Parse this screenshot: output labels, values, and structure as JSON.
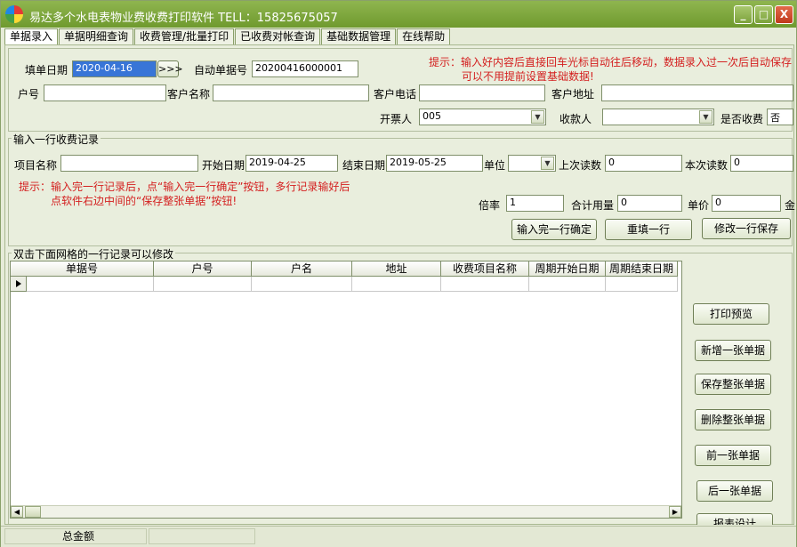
{
  "window": {
    "title": "易达多个水电表物业费收费打印软件   TELL：15825675057",
    "minimize": "_",
    "maximize": "□",
    "close": "X"
  },
  "tabs": [
    "单据录入",
    "单据明细查询",
    "收费管理/批量打印",
    "已收费对帐查询",
    "基础数据管理",
    "在线帮助"
  ],
  "header": {
    "fill_date_label": "填单日期",
    "fill_date_value": "2020-04-16",
    "date_button": ">>>",
    "auto_no_label": "自动单据号",
    "auto_no_value": "20200416000001",
    "hint_line1": "提示：输入好内容后直接回车光标自动往后移动，数据录入过一次后自动保存",
    "hint_line2": "可以不用提前设置基础数据!",
    "account_label": "户号",
    "customer_name_label": "客户名称",
    "customer_phone_label": "客户电话",
    "customer_address_label": "客户地址",
    "issuer_label": "开票人",
    "issuer_value": "005",
    "payee_label": "收款人",
    "payee_value": "",
    "charged_label": "是否收费",
    "charged_value": "否"
  },
  "row_entry": {
    "group_title": "输入一行收费记录",
    "item_name_label": "项目名称",
    "start_date_label": "开始日期",
    "start_date_value": "2019-04-25",
    "end_date_label": "结束日期",
    "end_date_value": "2019-05-25",
    "unit_label": "单位",
    "last_reading_label": "上次读数",
    "last_reading_value": "0",
    "this_reading_label": "本次读数",
    "this_reading_value": "0",
    "hint_line1": "提示：输入完一行记录后，点“输入完一行确定”按钮，多行记录输好后",
    "hint_line2": "点软件右边中间的“保存整张单据”按钮!",
    "ratio_label": "倍率",
    "ratio_value": "1",
    "total_usage_label": "合计用量",
    "total_usage_value": "0",
    "price_label": "单价",
    "price_value": "0",
    "amount_label": "金",
    "confirm_button": "输入完一行确定",
    "refill_button": "重填一行",
    "modify_button": "修改一行保存"
  },
  "records": {
    "group_title": "双击下面网格的一行记录可以修改",
    "columns": [
      "单据号",
      "户号",
      "户名",
      "地址",
      "收费项目名称",
      "周期开始日期",
      "周期结束日期"
    ],
    "rows": []
  },
  "side_buttons": [
    "打印预览",
    "新增一张单据",
    "保存整张单据",
    "删除整张单据",
    "前一张单据",
    "后一张单据",
    "报表设计"
  ],
  "status": {
    "total_label": "总金额",
    "total_value": ""
  }
}
